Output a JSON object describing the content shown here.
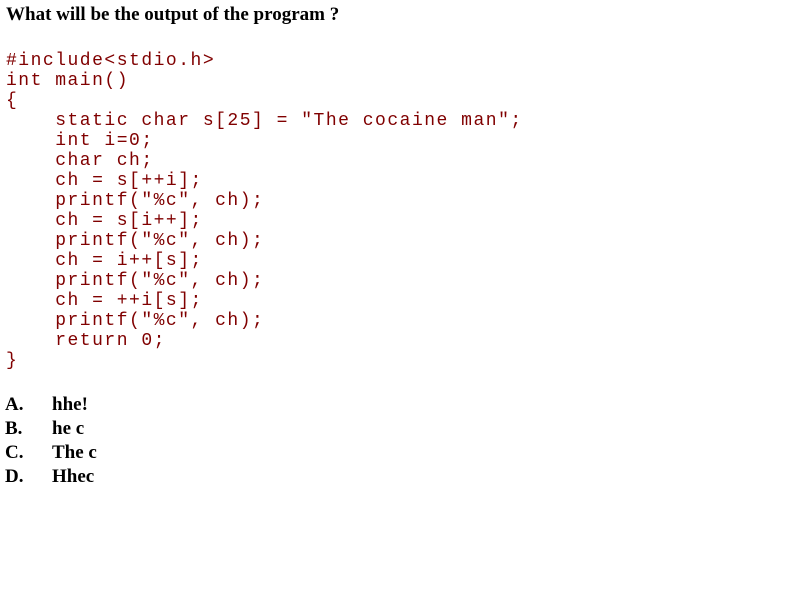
{
  "question": "What will be the output of the program ?",
  "code_lines": [
    "#include<stdio.h>",
    "int main()",
    "{",
    "    static char s[25] = \"The cocaine man\";",
    "    int i=0;",
    "    char ch;",
    "    ch = s[++i];",
    "    printf(\"%c\", ch);",
    "    ch = s[i++];",
    "    printf(\"%c\", ch);",
    "    ch = i++[s];",
    "    printf(\"%c\", ch);",
    "    ch = ++i[s];",
    "    printf(\"%c\", ch);",
    "    return 0;",
    "}"
  ],
  "options": [
    {
      "letter": "A.",
      "text": "hhe!"
    },
    {
      "letter": "B.",
      "text": "he c"
    },
    {
      "letter": "C.",
      "text": "The c"
    },
    {
      "letter": "D.",
      "text": "Hhec"
    }
  ],
  "colors": {
    "code": "#800000",
    "text": "#000000",
    "background": "#ffffff"
  }
}
